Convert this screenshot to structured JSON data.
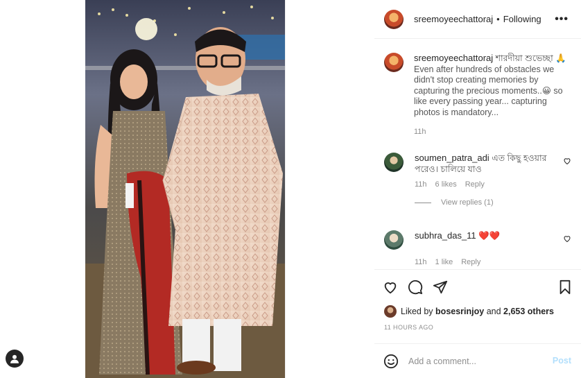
{
  "post": {
    "username": "sreemoyeechattoraj",
    "follow_sep": "•",
    "follow_label": "Following",
    "more_label": "•••"
  },
  "caption": {
    "username": "sreemoyeechattoraj",
    "text": "শারদীয়া শুভেচ্ছা 🙏 Even after hundreds of obstacles we didn't stop creating memories by capturing the precious moments..😀 so like every passing year... capturing photos is mandatory...",
    "time": "11h"
  },
  "comments": [
    {
      "username": "soumen_patra_adi",
      "text": "এত কিছু হওয়ার পরেও। চালিয়ে যাও",
      "time": "11h",
      "likes": "6 likes",
      "reply": "Reply",
      "view_replies": "View replies (1)"
    },
    {
      "username": "subhra_das_11",
      "text": "❤️❤️",
      "time": "11h",
      "likes": "1 like",
      "reply": "Reply"
    }
  ],
  "likes": {
    "prefix": "Liked by",
    "user": "bosesrinjoy",
    "suffix": "and",
    "others": "2,653 others"
  },
  "timestamp": "11 HOURS AGO",
  "add_comment": {
    "placeholder": "Add a comment...",
    "post_label": "Post"
  },
  "icons": {
    "like": "heart-icon",
    "comment": "comment-icon",
    "share": "share-icon",
    "save": "bookmark-icon",
    "emoji": "emoji-icon",
    "account": "account-icon",
    "more": "more-icon"
  },
  "colors": {
    "heart": "#ed4956",
    "post_disabled": "#b2dffc",
    "muted": "#8e8e8e"
  }
}
